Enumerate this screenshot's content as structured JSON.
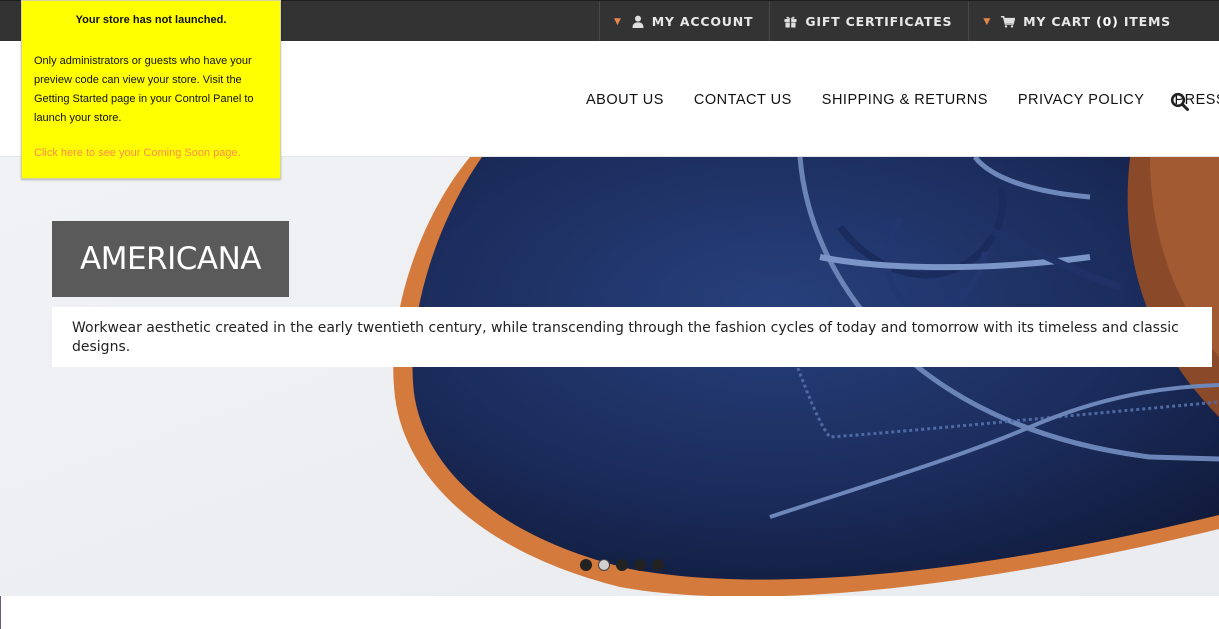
{
  "notice": {
    "title": "Your store has not launched.",
    "body": "Only administrators or guests who have your preview code can view your store. Visit the Getting Started page in your Control Panel to launch your store.",
    "link": "Click here to see your Coming Soon page."
  },
  "topbar": {
    "account": {
      "label": "MY ACCOUNT",
      "icon": "user-icon"
    },
    "gift": {
      "label": "GIFT CERTIFICATES",
      "icon": "gift-icon"
    },
    "cart": {
      "prefix": "MY CART",
      "count": "(0)",
      "suffix": "ITEMS",
      "icon": "cart-icon"
    }
  },
  "nav": {
    "items": [
      {
        "label": "ABOUT US"
      },
      {
        "label": "CONTACT US"
      },
      {
        "label": "SHIPPING & RETURNS"
      },
      {
        "label": "PRIVACY POLICY"
      },
      {
        "label": "PRESS"
      }
    ],
    "search_icon": "search-icon"
  },
  "hero": {
    "title": "AMERICANA",
    "description": "Workwear aesthetic created in the early twentieth century, while transcending through the fashion cycles of today and tomorrow with its timeless and classic designs.",
    "slide_count": 5,
    "active_slide": 2
  },
  "colors": {
    "topbar_bg": "#333333",
    "accent_caret": "#e9874a",
    "notice_bg": "#ffff00",
    "notice_link": "#ff8c52",
    "hero_title_bg": "#5a5a5a"
  }
}
